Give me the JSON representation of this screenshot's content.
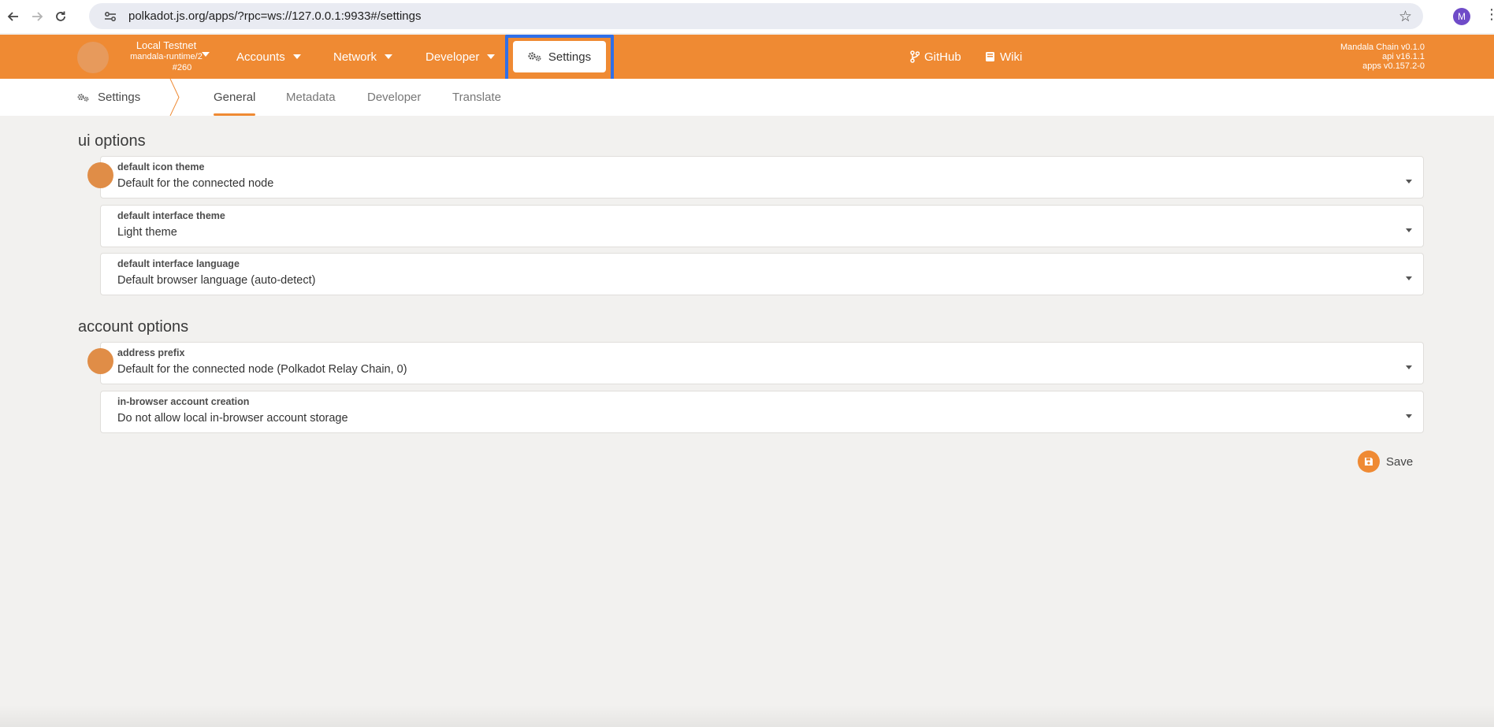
{
  "browser": {
    "url": "polkadot.js.org/apps/?rpc=ws://127.0.0.1:9933#/settings",
    "profile_initial": "M"
  },
  "header": {
    "chain_name": "Local Testnet",
    "runtime": "mandala-runtime/2",
    "block": "#260",
    "menu": {
      "accounts": "Accounts",
      "network": "Network",
      "developer": "Developer",
      "settings": "Settings"
    },
    "links": {
      "github": "GitHub",
      "wiki": "Wiki"
    },
    "versions": {
      "chain": "Mandala Chain v0.1.0",
      "api": "api v16.1.1",
      "apps": "apps v0.157.2-0"
    },
    "accent_color": "#ef8a33"
  },
  "subnav": {
    "title": "Settings",
    "tabs": [
      "General",
      "Metadata",
      "Developer",
      "Translate"
    ],
    "active_tab": "General"
  },
  "ui_options": {
    "title": "ui options",
    "fields": [
      {
        "label": "default icon theme",
        "value": "Default for the connected node"
      },
      {
        "label": "default interface theme",
        "value": "Light theme"
      },
      {
        "label": "default interface language",
        "value": "Default browser language (auto-detect)"
      }
    ]
  },
  "account_options": {
    "title": "account options",
    "fields": [
      {
        "label": "address prefix",
        "value": "Default for the connected node (Polkadot Relay Chain, 0)"
      },
      {
        "label": "in-browser account creation",
        "value": "Do not allow local in-browser account storage"
      }
    ]
  },
  "save_label": "Save"
}
